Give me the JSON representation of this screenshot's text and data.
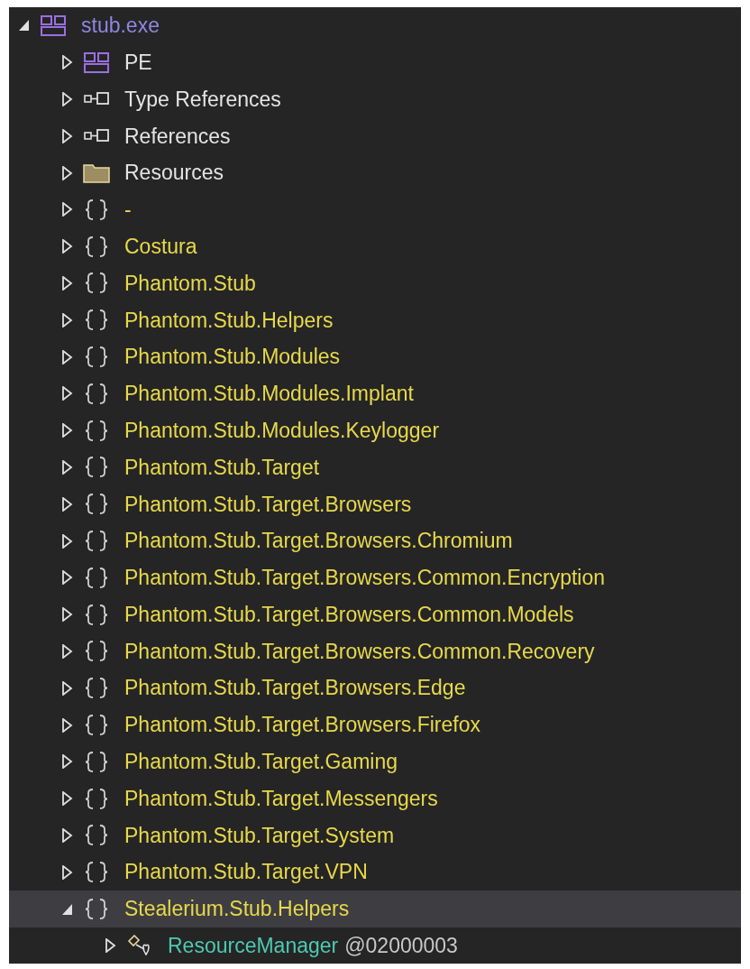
{
  "tree": [
    {
      "kind": "assembly",
      "label": "stub.exe",
      "expanded": true,
      "selected": false,
      "children": [
        {
          "kind": "pe",
          "label": "PE",
          "expanded": false,
          "selected": false
        },
        {
          "kind": "references",
          "label": "Type References",
          "expanded": false,
          "selected": false
        },
        {
          "kind": "references",
          "label": "References",
          "expanded": false,
          "selected": false
        },
        {
          "kind": "folder",
          "label": "Resources",
          "expanded": false,
          "selected": false
        },
        {
          "kind": "namespace",
          "label": "-",
          "expanded": false,
          "selected": false
        },
        {
          "kind": "namespace",
          "label": "Costura",
          "expanded": false,
          "selected": false
        },
        {
          "kind": "namespace",
          "label": "Phantom.Stub",
          "expanded": false,
          "selected": false
        },
        {
          "kind": "namespace",
          "label": "Phantom.Stub.Helpers",
          "expanded": false,
          "selected": false
        },
        {
          "kind": "namespace",
          "label": "Phantom.Stub.Modules",
          "expanded": false,
          "selected": false
        },
        {
          "kind": "namespace",
          "label": "Phantom.Stub.Modules.Implant",
          "expanded": false,
          "selected": false
        },
        {
          "kind": "namespace",
          "label": "Phantom.Stub.Modules.Keylogger",
          "expanded": false,
          "selected": false
        },
        {
          "kind": "namespace",
          "label": "Phantom.Stub.Target",
          "expanded": false,
          "selected": false
        },
        {
          "kind": "namespace",
          "label": "Phantom.Stub.Target.Browsers",
          "expanded": false,
          "selected": false
        },
        {
          "kind": "namespace",
          "label": "Phantom.Stub.Target.Browsers.Chromium",
          "expanded": false,
          "selected": false
        },
        {
          "kind": "namespace",
          "label": "Phantom.Stub.Target.Browsers.Common.Encryption",
          "expanded": false,
          "selected": false
        },
        {
          "kind": "namespace",
          "label": "Phantom.Stub.Target.Browsers.Common.Models",
          "expanded": false,
          "selected": false
        },
        {
          "kind": "namespace",
          "label": "Phantom.Stub.Target.Browsers.Common.Recovery",
          "expanded": false,
          "selected": false
        },
        {
          "kind": "namespace",
          "label": "Phantom.Stub.Target.Browsers.Edge",
          "expanded": false,
          "selected": false
        },
        {
          "kind": "namespace",
          "label": "Phantom.Stub.Target.Browsers.Firefox",
          "expanded": false,
          "selected": false
        },
        {
          "kind": "namespace",
          "label": "Phantom.Stub.Target.Gaming",
          "expanded": false,
          "selected": false
        },
        {
          "kind": "namespace",
          "label": "Phantom.Stub.Target.Messengers",
          "expanded": false,
          "selected": false
        },
        {
          "kind": "namespace",
          "label": "Phantom.Stub.Target.System",
          "expanded": false,
          "selected": false
        },
        {
          "kind": "namespace",
          "label": "Phantom.Stub.Target.VPN",
          "expanded": false,
          "selected": false
        },
        {
          "kind": "namespace",
          "label": "Stealerium.Stub.Helpers",
          "expanded": true,
          "selected": true,
          "children": [
            {
              "kind": "type",
              "label": "ResourceManager",
              "token": "@02000003",
              "expanded": false,
              "selected": false
            }
          ]
        }
      ]
    }
  ]
}
